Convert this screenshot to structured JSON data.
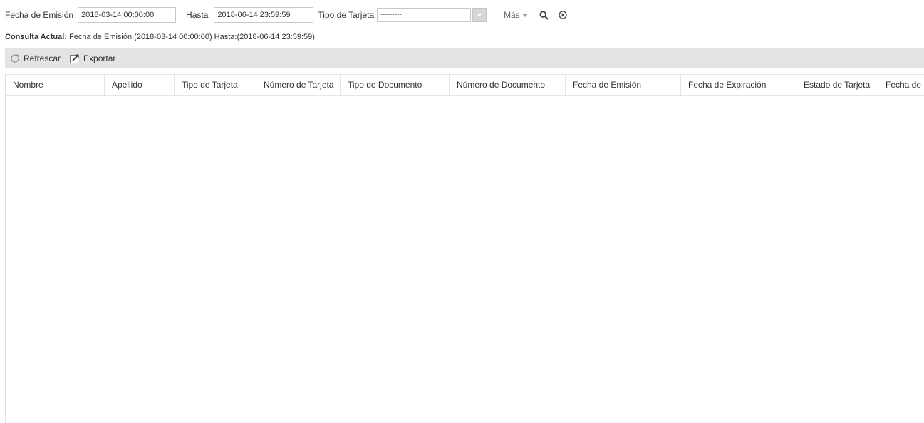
{
  "filters": {
    "fecha_emision_label": "Fecha de Emisión",
    "fecha_emision_value": "2018-03-14 00:00:00",
    "hasta_label": "Hasta",
    "hasta_value": "2018-06-14 23:59:59",
    "tipo_tarjeta_label": "Tipo de Tarjeta",
    "tipo_tarjeta_value": "---------",
    "mas_label": "Más"
  },
  "consulta": {
    "label": "Consulta Actual:",
    "text": "Fecha de Emisión:(2018-03-14 00:00:00)  Hasta:(2018-06-14 23:59:59)"
  },
  "toolbar": {
    "refresh_label": "Refrescar",
    "export_label": "Exportar"
  },
  "table": {
    "columns": [
      "Nombre",
      "Apellido",
      "Tipo de Tarjeta",
      "Número de Tarjeta",
      "Tipo de Documento",
      "Número de Documento",
      "Fecha de Emisión",
      "Fecha de Expiración",
      "Estado de Tarjeta",
      "Fecha de I"
    ],
    "rows": []
  },
  "icons": {
    "search": "search-icon",
    "clear": "clear-icon",
    "refresh": "refresh-icon",
    "export": "export-icon",
    "dropdown": "chevron-down-icon"
  }
}
